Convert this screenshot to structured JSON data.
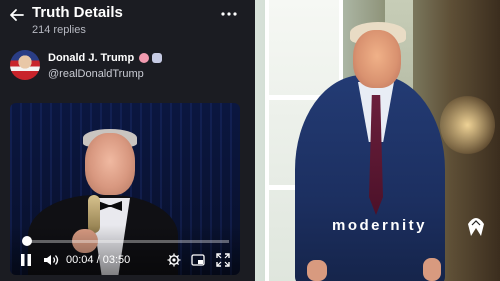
{
  "header": {
    "title": "Truth Details",
    "replies": "214 replies"
  },
  "post": {
    "author_name": "Donald J. Trump",
    "handle": "@realDonaldTrump"
  },
  "video": {
    "current_time": "00:04",
    "separator": "/",
    "duration": "03:50",
    "progress": 0.017
  },
  "photo": {
    "watermark": "modernity"
  },
  "icons": [
    "back-arrow-icon",
    "more-icon",
    "verified-badge-icon",
    "pause-icon",
    "volume-icon",
    "settings-icon",
    "picture-in-picture-icon",
    "fullscreen-icon"
  ],
  "colors": {
    "panel_bg": "#1b1c22",
    "text_primary": "#ffffff",
    "text_secondary": "#b7b9c2",
    "verified_badge": "#f29bb0"
  }
}
